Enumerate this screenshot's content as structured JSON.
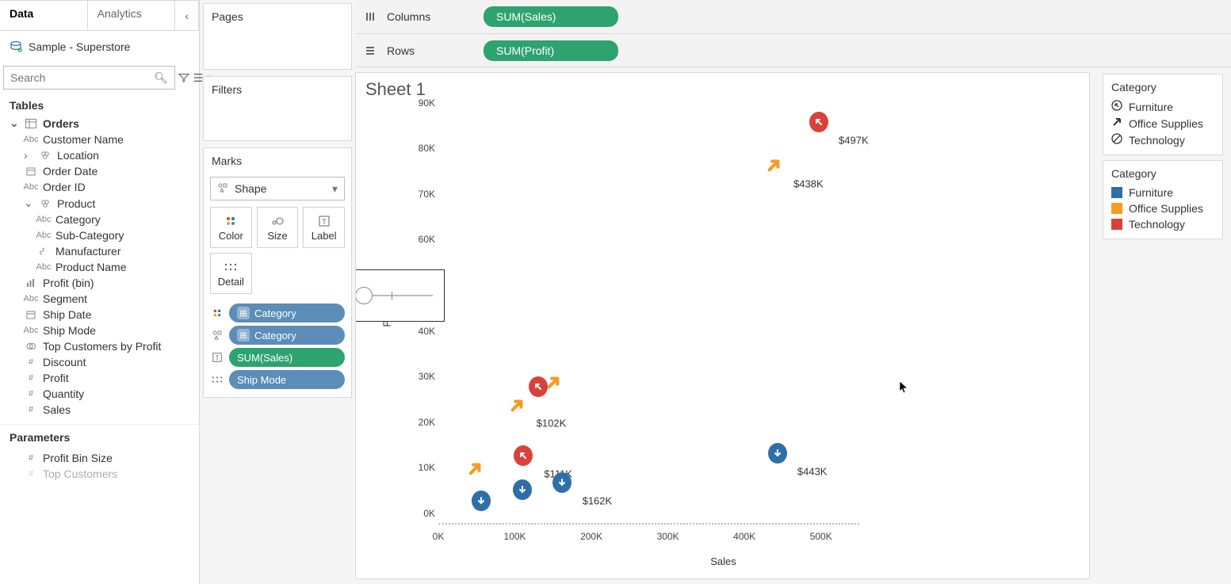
{
  "tabs": {
    "data": "Data",
    "analytics": "Analytics"
  },
  "datasource": "Sample - Superstore",
  "search_placeholder": "Search",
  "tables_title": "Tables",
  "parameters_title": "Parameters",
  "tree": {
    "orders": "Orders",
    "customer_name": "Customer Name",
    "location": "Location",
    "order_date": "Order Date",
    "order_id": "Order ID",
    "product": "Product",
    "category": "Category",
    "sub_category": "Sub-Category",
    "manufacturer": "Manufacturer",
    "product_name": "Product Name",
    "profit_bin": "Profit (bin)",
    "segment": "Segment",
    "ship_date": "Ship Date",
    "ship_mode": "Ship Mode",
    "top_customers": "Top Customers by Profit",
    "discount": "Discount",
    "profit": "Profit",
    "quantity": "Quantity",
    "sales": "Sales"
  },
  "params": {
    "profit_bin_size": "Profit Bin Size",
    "top_customers": "Top Customers"
  },
  "pages_title": "Pages",
  "filters_title": "Filters",
  "marks_title": "Marks",
  "shape_label": "Shape",
  "mark_btn": {
    "color": "Color",
    "size": "Size",
    "label": "Label",
    "detail": "Detail"
  },
  "mark_pills": {
    "category1": "Category",
    "category2": "Category",
    "sum_sales": "SUM(Sales)",
    "ship_mode": "Ship Mode"
  },
  "shelves": {
    "columns_label": "Columns",
    "rows_label": "Rows",
    "columns_pill": "SUM(Sales)",
    "rows_pill": "SUM(Profit)"
  },
  "sheet_title": "Sheet 1",
  "legend1_title": "Category",
  "legend1_items": [
    "Furniture",
    "Office Supplies",
    "Technology"
  ],
  "legend2_title": "Category",
  "legend2_items": [
    "Furniture",
    "Office Supplies",
    "Technology"
  ],
  "ylabel": "Profit",
  "xlabel": "Sales",
  "y_ticks": [
    "0K",
    "10K",
    "20K",
    "30K",
    "40K",
    "60K",
    "70K",
    "80K",
    "90K"
  ],
  "x_ticks": [
    "0K",
    "100K",
    "200K",
    "300K",
    "400K",
    "500K"
  ],
  "colors": {
    "furniture": "#2e6fa8",
    "office": "#f89b22",
    "technology": "#d9423a",
    "pill_blue": "#5b8db8",
    "pill_green": "#2ea36f"
  },
  "chart_data": {
    "type": "scatter",
    "xlabel": "Sales",
    "ylabel": "Profit",
    "xlim": [
      0,
      550000
    ],
    "ylim": [
      0,
      92000
    ],
    "x_ticks": [
      0,
      100000,
      200000,
      300000,
      400000,
      500000
    ],
    "y_ticks": [
      0,
      10000,
      20000,
      30000,
      40000,
      60000,
      70000,
      80000,
      90000
    ],
    "shape_legend": {
      "Furniture": "circle-arrow-up",
      "Office Supplies": "arrow-up-right",
      "Technology": "circle-no"
    },
    "color_legend": {
      "Furniture": "#2e6fa8",
      "Office Supplies": "#f89b22",
      "Technology": "#d9423a"
    },
    "points": [
      {
        "sales": 497000,
        "profit": 84000,
        "category": "Technology",
        "label": "$497K",
        "color": "#d9423a",
        "shape": "circle-arrow"
      },
      {
        "sales": 438000,
        "profit": 74500,
        "category": "Office Supplies",
        "label": "$438K",
        "color": "#f89b22",
        "shape": "arrow"
      },
      {
        "sales": 150000,
        "profit": 27000,
        "category": "Office Supplies",
        "label": null,
        "color": "#f89b22",
        "shape": "arrow"
      },
      {
        "sales": 130000,
        "profit": 26000,
        "category": "Technology",
        "label": null,
        "color": "#d9423a",
        "shape": "circle-arrow"
      },
      {
        "sales": 102000,
        "profit": 22000,
        "category": "Office Supplies",
        "label": "$102K",
        "color": "#f89b22",
        "shape": "arrow"
      },
      {
        "sales": 111000,
        "profit": 11000,
        "category": "Technology",
        "label": "$111K",
        "color": "#d9423a",
        "shape": "circle-arrow"
      },
      {
        "sales": 48000,
        "profit": 8000,
        "category": "Office Supplies",
        "label": null,
        "color": "#f89b22",
        "shape": "arrow"
      },
      {
        "sales": 110000,
        "profit": 3500,
        "category": "Furniture",
        "label": null,
        "color": "#2e6fa8",
        "shape": "circle-down"
      },
      {
        "sales": 162000,
        "profit": 5000,
        "category": "Furniture",
        "label": "$162K",
        "color": "#2e6fa8",
        "shape": "circle-down"
      },
      {
        "sales": 56000,
        "profit": 1000,
        "category": "Furniture",
        "label": null,
        "color": "#2e6fa8",
        "shape": "circle-down"
      },
      {
        "sales": 443000,
        "profit": 11500,
        "category": "Furniture",
        "label": "$443K",
        "color": "#2e6fa8",
        "shape": "circle-down"
      }
    ]
  }
}
